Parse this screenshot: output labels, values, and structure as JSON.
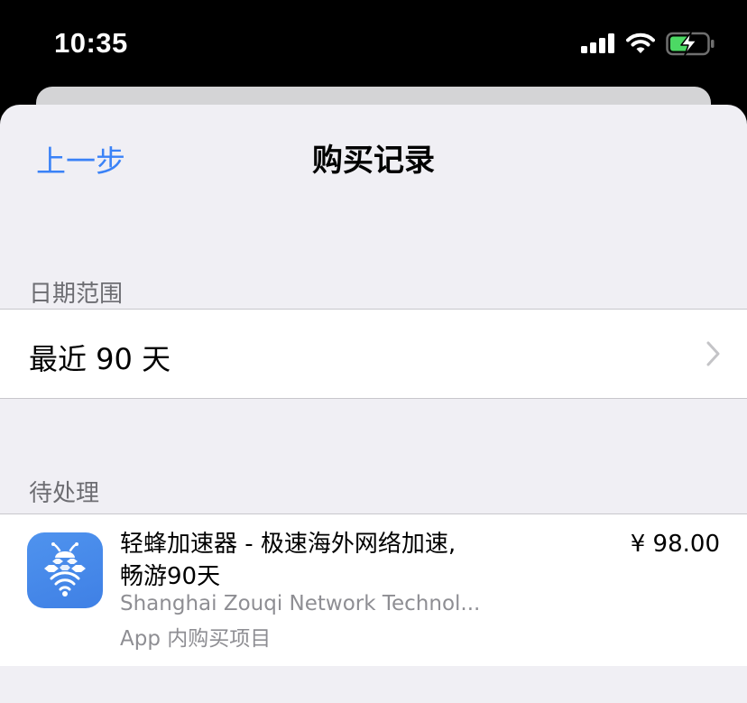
{
  "status_bar": {
    "time": "10:35",
    "icons": [
      "signal-icon",
      "wifi-icon",
      "battery-charging-icon"
    ],
    "battery_color": "#4cd964"
  },
  "nav": {
    "back_label": "上一步",
    "title": "购买记录",
    "accent_color": "#3a82f7"
  },
  "date_range": {
    "header": "日期范围",
    "value": "最近 90 天",
    "icon": "chevron-right-icon"
  },
  "pending": {
    "header": "待处理",
    "items": [
      {
        "name": "轻蜂加速器 - 极速海外网络加速, 畅游90天",
        "developer": "Shanghai Zouqi Network Technol...",
        "type": "App 内购买项目",
        "price": "¥ 98.00",
        "icon": "bee-app-icon"
      }
    ]
  }
}
